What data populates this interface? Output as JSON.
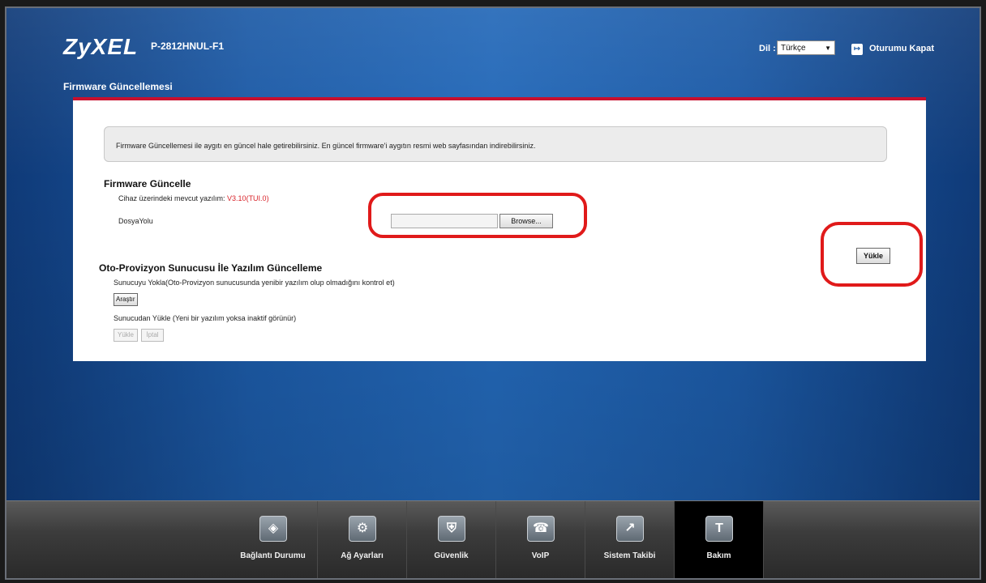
{
  "header": {
    "brand": "ZyXEL",
    "model": "P-2812HNUL-F1",
    "language_label": "Dil :",
    "language_value": "Türkçe",
    "logout_label": "Oturumu Kapat"
  },
  "page": {
    "title": "Firmware Güncellemesi",
    "info_text": "Firmware Güncellemesi ile aygıtı en güncel hale getirebilirsiniz. En güncel firmware'i aygıtın resmi web sayfasından indirebilirsiniz."
  },
  "firmware_update": {
    "section_title": "Firmware Güncelle",
    "current_version_label": "Cihaz üzerindeki mevcut yazılım: ",
    "current_version_value": "V3.10(TUI.0)",
    "file_path_label": "DosyaYolu",
    "browse_label": "Browse...",
    "upload_label": "Yükle"
  },
  "auto_provision": {
    "section_title": "Oto-Provizyon Sunucusu İle Yazılım Güncelleme",
    "check_text": "Sunucuyu Yokla(Oto-Provizyon sunucusunda yenibir yazılım olup olmadığını kontrol et)",
    "search_button": "Araştır",
    "load_text": "Sunucudan Yükle (Yeni bir yazılım yoksa inaktif görünür)",
    "load_button": "Yükle",
    "cancel_button": "İptal"
  },
  "taskbar": {
    "items": [
      {
        "label": "Bağlantı Durumu",
        "icon": "network-status-icon"
      },
      {
        "label": "Ağ Ayarları",
        "icon": "gear-icon"
      },
      {
        "label": "Güvenlik",
        "icon": "shield-icon"
      },
      {
        "label": "VoIP",
        "icon": "phone-icon"
      },
      {
        "label": "Sistem Takibi",
        "icon": "monitor-chart-icon"
      },
      {
        "label": "Bakım",
        "icon": "maintenance-icon"
      }
    ],
    "active_index": 5
  },
  "annotation_color": "#e01a1a"
}
